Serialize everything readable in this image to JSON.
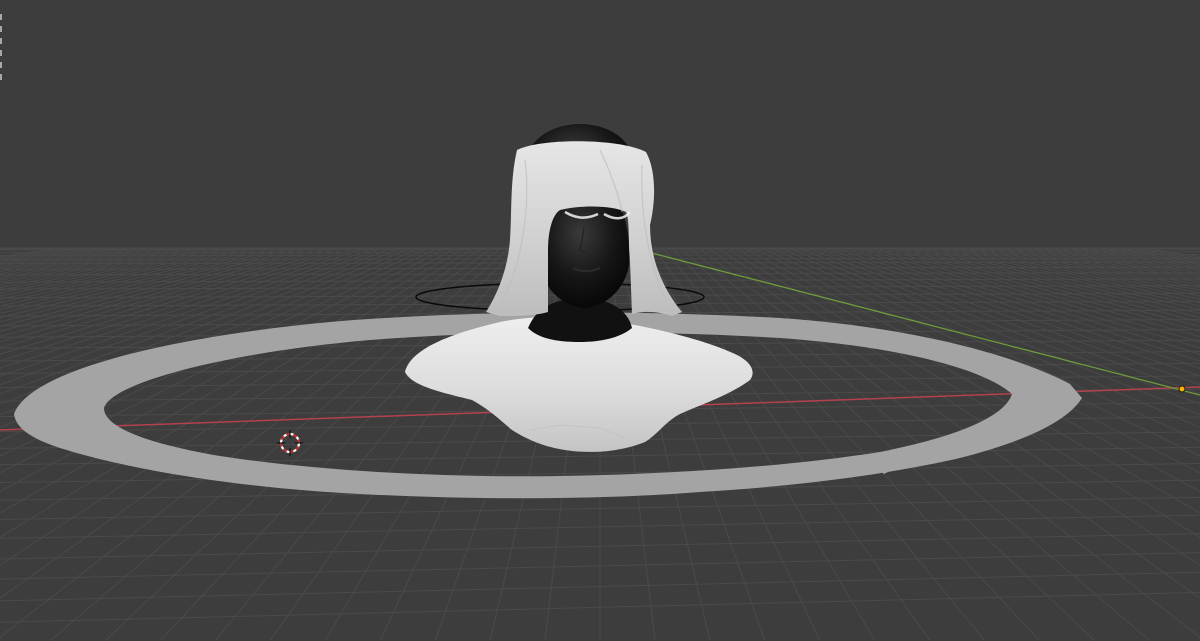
{
  "app": {
    "kind": "3D modeling viewport",
    "shading": "solid"
  },
  "viewport": {
    "background_color": "#3d3d3d",
    "grid_color": "#474747",
    "x_axis_color": "#b3424c",
    "y_axis_color": "#6e9b3b"
  },
  "scene": {
    "objects": [
      {
        "name": "floor-ring",
        "color": "#a4a4a4"
      },
      {
        "name": "head",
        "color": "#141414"
      },
      {
        "name": "hair-cloth",
        "color": "#d8d8d8"
      },
      {
        "name": "shoulder-cloth",
        "color": "#e2e2e2"
      },
      {
        "name": "empty-circle",
        "color": "#0a0a0a"
      },
      {
        "name": "3d-cursor",
        "color": "#c82f2f"
      },
      {
        "name": "light-point",
        "color": "#ffb400"
      }
    ]
  },
  "icons": [
    "3d-cursor-icon",
    "light-origin-icon"
  ]
}
